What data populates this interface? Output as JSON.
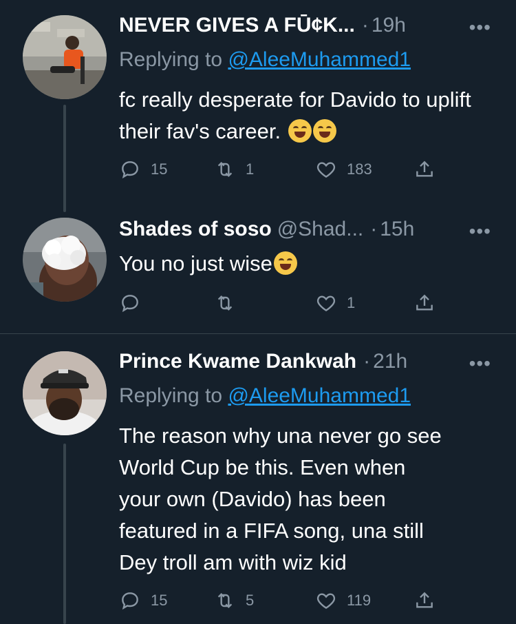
{
  "tweets": [
    {
      "name": "NEVER GIVES A FŪ¢K...",
      "handle": "",
      "time": "19h",
      "replying_prefix": "Replying to ",
      "replying_to": "@AleeMuhammed1",
      "text": "fc really desperate for Davido to uplift their fav's career.",
      "emojis": [
        "rolling-on-floor-laughing",
        "rolling-on-floor-laughing"
      ],
      "replies": "15",
      "retweets": "1",
      "likes": "183"
    },
    {
      "name": "Shades of soso",
      "handle": "@Shad...",
      "time": "15h",
      "text": "You no just wise",
      "emojis": [
        "face-with-tears-of-joy"
      ],
      "replies": "",
      "retweets": "",
      "likes": "1"
    },
    {
      "name": "Prince Kwame Dankwah",
      "handle": "",
      "time": "21h",
      "replying_prefix": "Replying to ",
      "replying_to": "@AleeMuhammed1",
      "text_lines": [
        "The reason why una never go see",
        "World Cup be this. Even when",
        "your own (Davido) has been",
        "featured in a FIFA song, una still",
        "Dey troll am with wiz kid"
      ],
      "replies": "15",
      "retweets": "5",
      "likes": "119"
    }
  ],
  "dot_separator": "·",
  "more_label": "•••",
  "colors": {
    "background": "#15202b",
    "text_primary": "#ffffff",
    "text_secondary": "#8b98a5",
    "link": "#1d9bf0",
    "divider": "#38444d"
  },
  "icons": [
    "reply-icon",
    "retweet-icon",
    "like-icon",
    "share-icon",
    "more-icon"
  ]
}
